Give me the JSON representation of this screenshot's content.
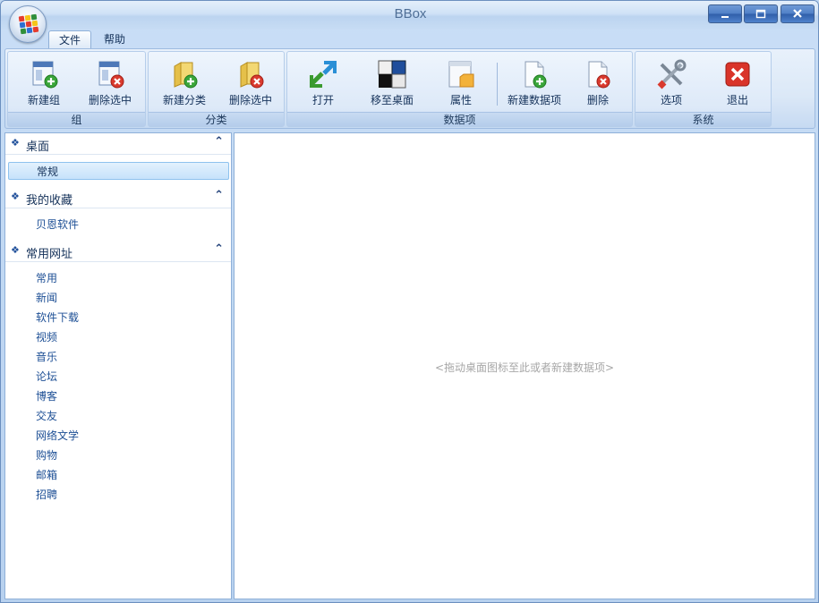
{
  "window": {
    "title": "BBox"
  },
  "menu": {
    "tabs": [
      "文件",
      "帮助"
    ]
  },
  "ribbon": {
    "groups": [
      {
        "label": "组",
        "buttons": [
          {
            "label": "新建组",
            "icon": "new-group-icon"
          },
          {
            "label": "删除选中",
            "icon": "delete-group-icon"
          }
        ]
      },
      {
        "label": "分类",
        "buttons": [
          {
            "label": "新建分类",
            "icon": "new-category-folder-icon"
          },
          {
            "label": "删除选中",
            "icon": "delete-category-folder-icon"
          }
        ]
      },
      {
        "label": "数据项",
        "buttons": [
          {
            "label": "打开",
            "icon": "open-arrows-icon"
          },
          {
            "label": "移至桌面",
            "icon": "move-to-desktop-icon"
          },
          {
            "label": "属性",
            "icon": "properties-icon"
          },
          {
            "label": "新建数据项",
            "icon": "new-item-icon"
          },
          {
            "label": "删除",
            "icon": "delete-item-icon"
          }
        ]
      },
      {
        "label": "系统",
        "buttons": [
          {
            "label": "选项",
            "icon": "options-tools-icon"
          },
          {
            "label": "退出",
            "icon": "exit-icon"
          }
        ]
      }
    ]
  },
  "sidebar": {
    "sections": [
      {
        "title": "桌面",
        "items": [
          "常规"
        ]
      },
      {
        "title": "我的收藏",
        "items": [
          "贝恩软件"
        ]
      },
      {
        "title": "常用网址",
        "items": [
          "常用",
          "新闻",
          "软件下载",
          "视频",
          "音乐",
          "论坛",
          "博客",
          "交友",
          "网络文学",
          "购物",
          "邮箱",
          "招聘"
        ]
      }
    ]
  },
  "main": {
    "empty_hint": "<拖动桌面图标至此或者新建数据项>"
  },
  "colors": {
    "accent": "#4f7fc7",
    "ribbon_bg": "#dbe8f7",
    "link": "#1d4f95",
    "selection": "#c6e2fb"
  }
}
